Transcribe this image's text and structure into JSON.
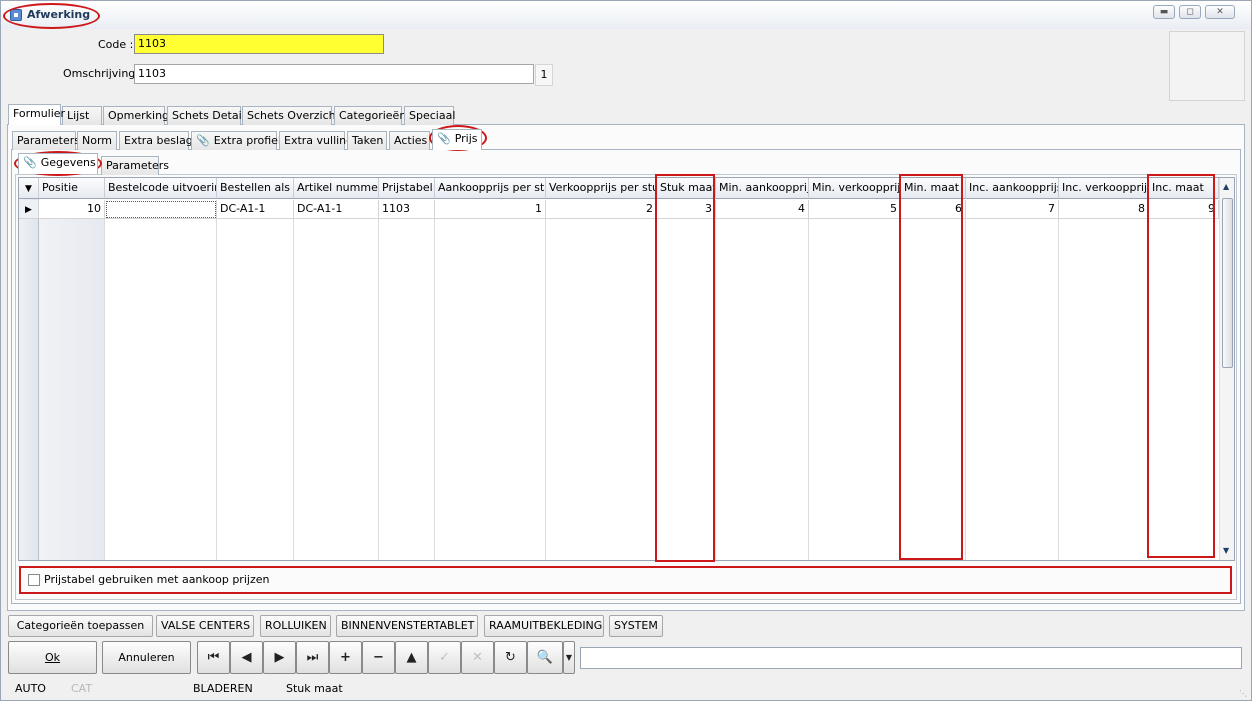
{
  "window": {
    "title": "Afwerking",
    "minimize_icon": "minimize-icon",
    "maximize_icon": "maximize-icon",
    "close_icon": "close-icon"
  },
  "form": {
    "code_label": "Code :",
    "code_value": "1103",
    "omschrijving_label": "Omschrijving :",
    "omschrijving_value": "1103",
    "counter": "1"
  },
  "main_tabs": [
    "Formulier",
    "Lijst",
    "Opmerking",
    "Schets Detail",
    "Schets Overzicht",
    "Categorieën",
    "Speciaal"
  ],
  "sub_tabs": [
    "Parameters",
    "Norm",
    "Extra beslag",
    "Extra profiel",
    "Extra vulling",
    "Taken",
    "Acties",
    "Prijs"
  ],
  "inner_tabs": [
    "Gegevens",
    "Parameters"
  ],
  "grid": {
    "headers": [
      "Positie",
      "Bestelcode uitvoering",
      "Bestellen als",
      "Artikel nummer",
      "Prijstabel",
      "Aankoopprijs per stuk",
      "Verkoopprijs per stuk",
      "Stuk maat",
      "Min. aankoopprijs",
      "Min. verkoopprijs",
      "Min. maat",
      "Inc. aankoopprijs",
      "Inc. verkoopprijs",
      "Inc. maat"
    ],
    "row": [
      "10",
      "",
      "DC-A1-1",
      "DC-A1-1",
      "1103",
      "1",
      "2",
      "3",
      "4",
      "5",
      "6",
      "7",
      "8",
      "9"
    ]
  },
  "checkbox": {
    "label": "Prijstabel gebruiken met aankoop prijzen",
    "checked": false
  },
  "categories": {
    "apply_button": "Categorieën toepassen",
    "items": [
      "VALSE CENTERS",
      "ROLLUIKEN",
      "BINNENVENSTERTABLET",
      "RAAMUITBEKLEDING",
      "SYSTEM"
    ]
  },
  "toolbar": {
    "ok": "Ok",
    "annuleren": "Annuleren",
    "nav_icons": [
      "first-record-icon",
      "prior-record-icon",
      "next-record-icon",
      "last-record-icon",
      "insert-icon",
      "delete-icon",
      "edit-icon",
      "post-icon",
      "cancel-edit-icon",
      "refresh-icon",
      "find-icon"
    ]
  },
  "status": {
    "mode": "AUTO",
    "cat": "CAT",
    "state": "BLADEREN",
    "field": "Stuk maat"
  },
  "colors": {
    "highlight": "#ffff32",
    "annotation": "#cc1818"
  }
}
